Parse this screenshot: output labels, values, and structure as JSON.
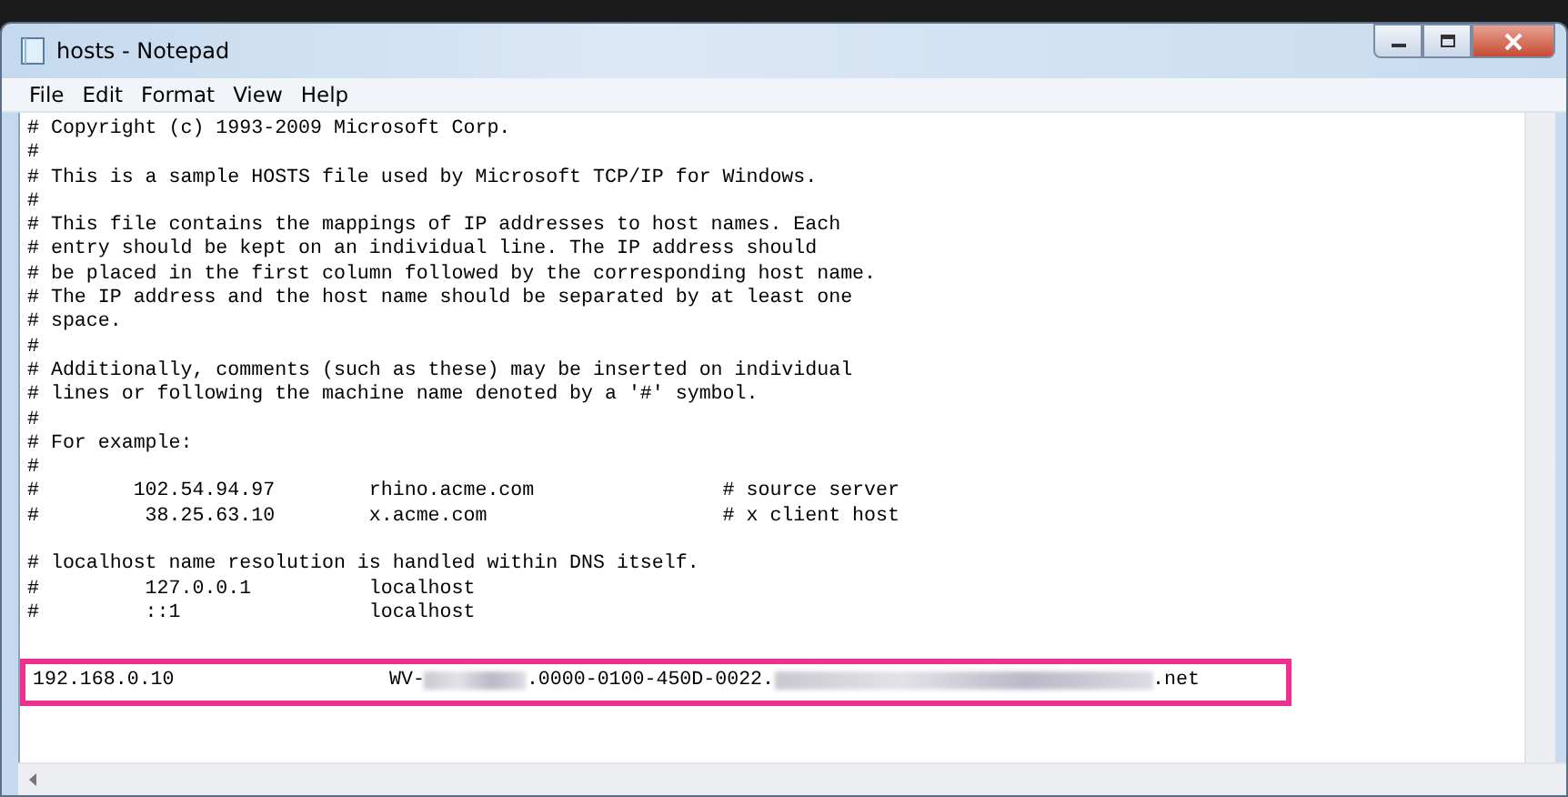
{
  "window": {
    "title": "hosts - Notepad"
  },
  "menu": [
    "File",
    "Edit",
    "Format",
    "View",
    "Help"
  ],
  "lines": [
    {
      "kind": "text",
      "text": "# Copyright (c) 1993-2009 Microsoft Corp."
    },
    {
      "kind": "text",
      "text": "#"
    },
    {
      "kind": "text",
      "text": "# This is a sample HOSTS file used by Microsoft TCP/IP for Windows."
    },
    {
      "kind": "text",
      "text": "#"
    },
    {
      "kind": "text",
      "text": "# This file contains the mappings of IP addresses to host names. Each"
    },
    {
      "kind": "text",
      "text": "# entry should be kept on an individual line. The IP address should"
    },
    {
      "kind": "text",
      "text": "# be placed in the first column followed by the corresponding host name."
    },
    {
      "kind": "text",
      "text": "# The IP address and the host name should be separated by at least one"
    },
    {
      "kind": "text",
      "text": "# space."
    },
    {
      "kind": "text",
      "text": "#"
    },
    {
      "kind": "text",
      "text": "# Additionally, comments (such as these) may be inserted on individual"
    },
    {
      "kind": "text",
      "text": "# lines or following the machine name denoted by a '#' symbol."
    },
    {
      "kind": "text",
      "text": "#"
    },
    {
      "kind": "text",
      "text": "# For example:"
    },
    {
      "kind": "text",
      "text": "#"
    },
    {
      "kind": "text",
      "text": "#        102.54.94.97        rhino.acme.com                # source server"
    },
    {
      "kind": "text",
      "text": "#         38.25.63.10        x.acme.com                    # x client host"
    },
    {
      "kind": "blank"
    },
    {
      "kind": "text",
      "text": "# localhost name resolution is handled within DNS itself."
    },
    {
      "kind": "text",
      "text": "#         127.0.0.1          localhost"
    },
    {
      "kind": "text",
      "text": "#         ::1                localhost"
    },
    {
      "kind": "blank"
    },
    {
      "kind": "entry",
      "highlighted": true,
      "ip": "192.168.0.10",
      "host_parts": [
        "WV-",
        ".0000-0100-450D-0022.",
        ".net"
      ]
    }
  ]
}
